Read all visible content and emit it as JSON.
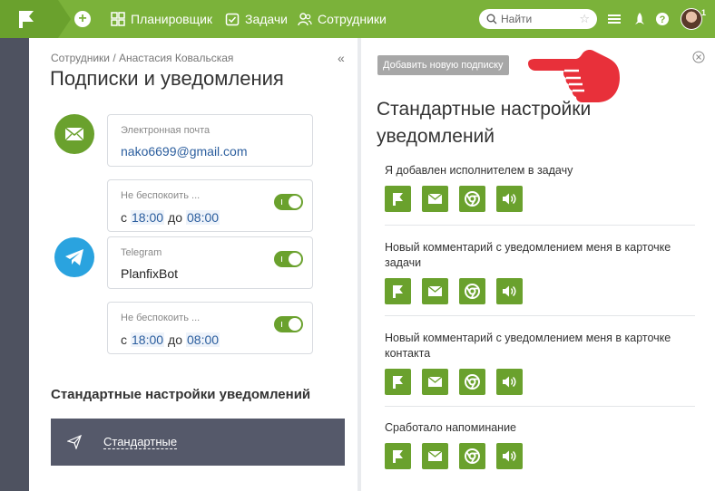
{
  "topbar": {
    "nav": [
      {
        "label": "Планировщик",
        "icon": "planner-icon"
      },
      {
        "label": "Задачи",
        "icon": "tasks-icon"
      },
      {
        "label": "Сотрудники",
        "icon": "people-icon"
      }
    ],
    "search_placeholder": "Найти",
    "avatar_badge": "1"
  },
  "left": {
    "breadcrumb": "Сотрудники / Анастасия Ковальская",
    "title": "Подписки и уведомления",
    "email": {
      "label": "Электронная почта",
      "value": "nako6699@gmail.com"
    },
    "dnd1": {
      "label": "Не беспокоить ...",
      "from_word": "с",
      "from": "18:00",
      "to_word": "до",
      "to": "08:00"
    },
    "telegram": {
      "label": "Telegram",
      "value": "PlanfixBot"
    },
    "dnd2": {
      "label": "Не беспокоить ...",
      "from_word": "с",
      "from": "18:00",
      "to_word": "до",
      "to": "08:00"
    },
    "section_title": "Стандартные настройки уведомлений",
    "standard_label": "Стандартные"
  },
  "right": {
    "add_button": "Добавить новую подписку",
    "title": "Стандартные настройки уведомлений",
    "notifications": [
      {
        "text": "Я добавлен исполнителем в задачу"
      },
      {
        "text": "Новый комментарий с уведомлением меня в карточке задачи"
      },
      {
        "text": "Новый комментарий с уведомлением меня в карточке контакта"
      },
      {
        "text": "Сработало напоминание"
      }
    ]
  },
  "colors": {
    "brand_green": "#7bb23a",
    "button_green": "#6aa12d",
    "email_circle": "#6aa12d",
    "telegram_circle": "#2aa3df",
    "pointer_red": "#e8303a"
  }
}
